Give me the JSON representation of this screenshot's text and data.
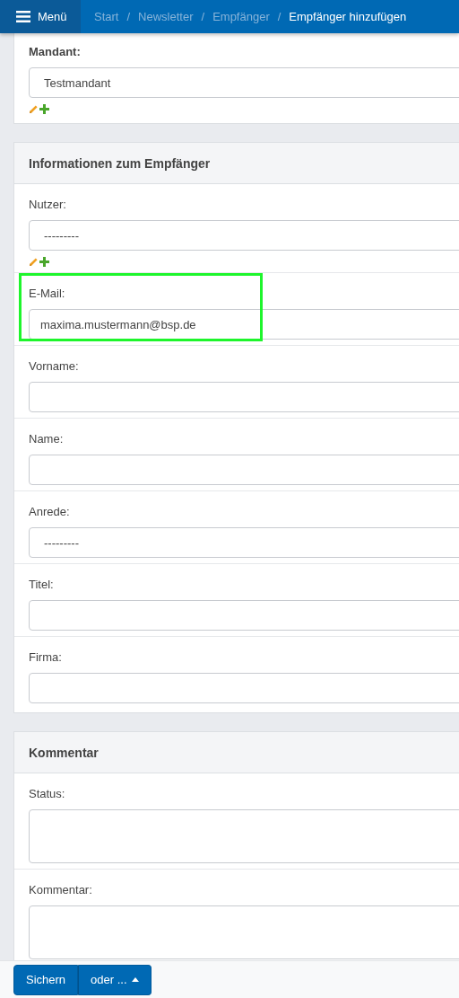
{
  "header": {
    "menu_button": "Menü",
    "separator": "/",
    "breadcrumbs": [
      {
        "label": "Start",
        "current": false
      },
      {
        "label": "Newsletter",
        "current": false
      },
      {
        "label": "Empfänger",
        "current": false
      },
      {
        "label": "Empfänger hinzufügen",
        "current": true
      }
    ]
  },
  "sections": [
    {
      "fields": [
        {
          "label": "Mandant:",
          "kind": "select",
          "value": "Testmandant",
          "label_bold": true,
          "actions": true,
          "highlighted": false
        }
      ]
    },
    {
      "title": "Informationen zum Empfänger",
      "fields": [
        {
          "label": "Nutzer:",
          "kind": "select",
          "value": "---------",
          "label_bold": false,
          "actions": true,
          "highlighted": false
        },
        {
          "label": "E-Mail:",
          "kind": "text",
          "value": "maxima.mustermann@bsp.de",
          "label_bold": false,
          "actions": false,
          "highlighted": true
        },
        {
          "label": "Vorname:",
          "kind": "text",
          "label_bold": false,
          "actions": false,
          "highlighted": false
        },
        {
          "label": "Name:",
          "kind": "text",
          "label_bold": false,
          "actions": false,
          "highlighted": false
        },
        {
          "label": "Anrede:",
          "kind": "select",
          "value": "---------",
          "label_bold": false,
          "actions": false,
          "highlighted": false
        },
        {
          "label": "Titel:",
          "kind": "text",
          "label_bold": false,
          "actions": false,
          "highlighted": false
        },
        {
          "label": "Firma:",
          "kind": "text",
          "label_bold": false,
          "actions": false,
          "highlighted": false
        }
      ]
    },
    {
      "title": "Kommentar",
      "fields": [
        {
          "label": "Status:",
          "kind": "textarea",
          "label_bold": false,
          "actions": false,
          "highlighted": false
        },
        {
          "label": "Kommentar:",
          "kind": "textarea",
          "label_bold": false,
          "actions": false,
          "highlighted": false
        }
      ]
    }
  ],
  "footer": {
    "save_button": "Sichern",
    "more_button": "oder ..."
  }
}
